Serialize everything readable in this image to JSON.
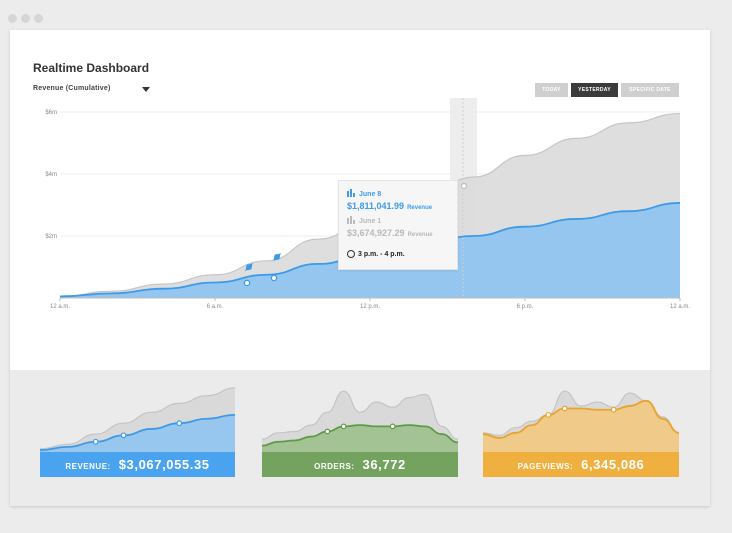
{
  "window": {
    "title": "Realtime Dashboard",
    "metric_selector": "Revenue (Cumulative)"
  },
  "date_range": {
    "options": [
      "TODAY",
      "YESTERDAY",
      "SPECIFIC DATE"
    ],
    "selected": "YESTERDAY"
  },
  "tooltip": {
    "current_date": "June 8",
    "current_value": "$1,811,041.99",
    "current_unit": "Revenue",
    "compare_date": "June 1",
    "compare_value": "$3,674,927.29",
    "compare_unit": "Revenue",
    "time_range": "3 p.m. - 4 p.m."
  },
  "colors": {
    "blue": "#58a8ea",
    "green": "#74a35f",
    "orange": "#f0b040",
    "gray": "#d9d9d9"
  },
  "chart_data": {
    "type": "area",
    "y_ticks": [
      "$6m",
      "$4m",
      "$2m"
    ],
    "x_ticks": [
      "12 a.m.",
      "6 a.m.",
      "12 p.m.",
      "6 p.m.",
      "12 a.m."
    ],
    "ylim": [
      0,
      6000000
    ],
    "x": [
      0,
      2,
      4,
      6,
      8,
      10,
      12,
      14,
      16,
      18,
      20,
      22,
      24
    ],
    "series": [
      {
        "name": "June 8",
        "values": [
          50000,
          150000,
          300000,
          500000,
          750000,
          1100000,
          1400000,
          1750000,
          2000000,
          2300000,
          2550000,
          2800000,
          3067055
        ]
      },
      {
        "name": "June 1",
        "values": [
          50000,
          220000,
          450000,
          750000,
          1200000,
          1900000,
          2500000,
          3200000,
          3900000,
          4600000,
          5150000,
          5650000,
          5950000
        ]
      }
    ],
    "grid": true
  },
  "cards": [
    {
      "label": "REVENUE:",
      "value": "$3,067,055.35",
      "color": "#4aa3ee"
    },
    {
      "label": "ORDERS:",
      "value": "36,772",
      "color": "#74a35f"
    },
    {
      "label": "PAGEVIEWS:",
      "value": "6,345,086",
      "color": "#f0b040"
    }
  ]
}
